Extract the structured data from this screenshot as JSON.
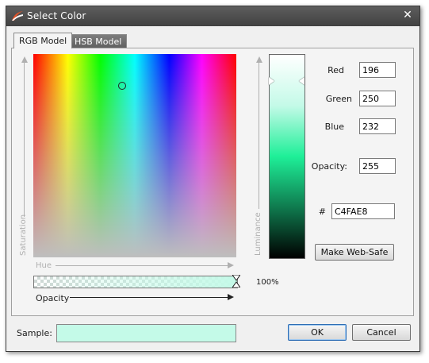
{
  "window": {
    "title": "Select Color",
    "close_icon": "close-icon"
  },
  "tabs": [
    {
      "label": "RGB Model",
      "active": true
    },
    {
      "label": "HSB Model",
      "active": false
    }
  ],
  "color_area": {
    "x_axis_label": "Hue",
    "y_axis_label": "Saturation",
    "cursor_icon": "circle-cursor-icon"
  },
  "opacity_slider": {
    "label": "Opacity",
    "value_text": "100%",
    "value": 1.0
  },
  "luminance": {
    "label": "Luminance",
    "level": 0.12
  },
  "fields": {
    "red": {
      "label": "Red",
      "value": "196"
    },
    "green": {
      "label": "Green",
      "value": "250"
    },
    "blue": {
      "label": "Blue",
      "value": "232"
    },
    "opacity": {
      "label": "Opacity:",
      "value": "255"
    },
    "hex": {
      "label": "#",
      "value": "C4FAE8"
    }
  },
  "buttons": {
    "make_web_safe": "Make Web-Safe",
    "ok": "OK",
    "cancel": "Cancel"
  },
  "sample": {
    "label": "Sample:",
    "color": "#C4FAE8"
  },
  "colors": {
    "titlebar": "#4a4a4a",
    "accent_logo": "#e0542a"
  }
}
